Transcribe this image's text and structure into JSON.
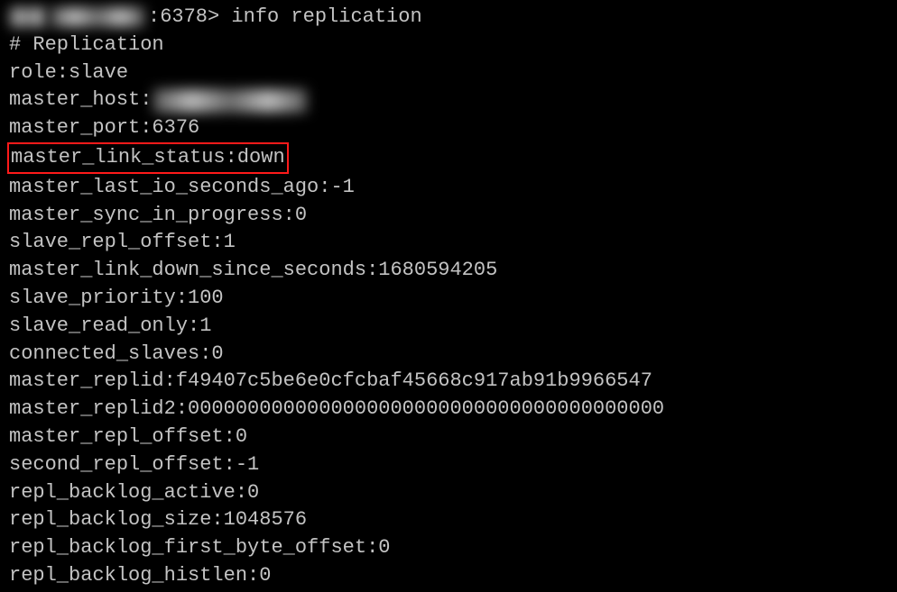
{
  "terminal": {
    "prompt_port": ":6378>",
    "command": "info replication",
    "section_header": "# Replication",
    "lines": {
      "role": "role:slave",
      "master_host_key": "master_host:",
      "master_port": "master_port:6376",
      "master_link_status": "master_link_status:down",
      "master_last_io": "master_last_io_seconds_ago:-1",
      "master_sync": "master_sync_in_progress:0",
      "slave_repl_offset": "slave_repl_offset:1",
      "master_link_down": "master_link_down_since_seconds:1680594205",
      "slave_priority": "slave_priority:100",
      "slave_read_only": "slave_read_only:1",
      "connected_slaves": "connected_slaves:0",
      "master_replid": "master_replid:f49407c5be6e0cfcbaf45668c917ab91b9966547",
      "master_replid2": "master_replid2:0000000000000000000000000000000000000000",
      "master_repl_offset": "master_repl_offset:0",
      "second_repl_offset": "second_repl_offset:-1",
      "repl_backlog_active": "repl_backlog_active:0",
      "repl_backlog_size": "repl_backlog_size:1048576",
      "repl_backlog_first": "repl_backlog_first_byte_offset:0",
      "repl_backlog_histlen": "repl_backlog_histlen:0"
    }
  }
}
